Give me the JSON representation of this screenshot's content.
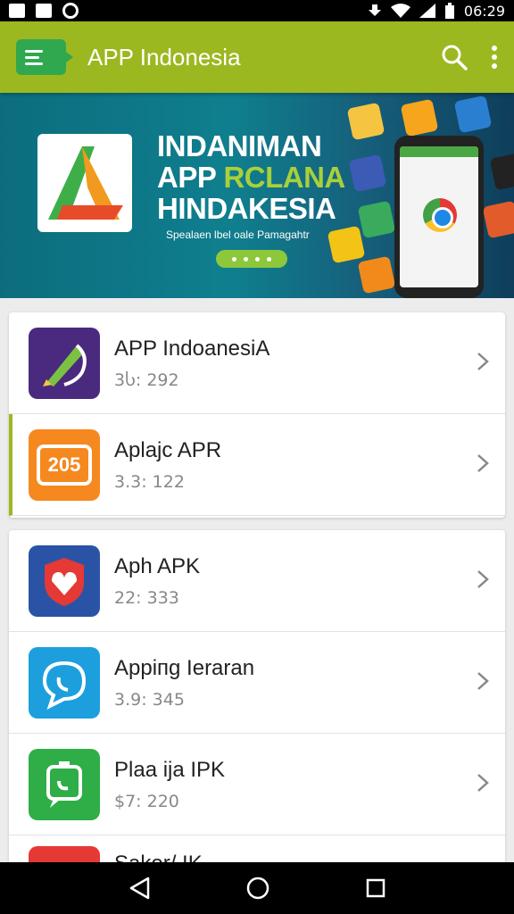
{
  "status_bar": {
    "time": "06:29"
  },
  "app_bar": {
    "title": "APP Indonesia"
  },
  "banner": {
    "line1": "INDANIMAN",
    "line2a": "APP ",
    "line2b": "RCLANA",
    "line3": "HINDAKESIA",
    "subtitle": "Spealaen lbel oale Pamagahtr"
  },
  "apps": [
    {
      "title": "APP IndoanesiA",
      "subtitle": "3Ⴑ: 292",
      "icon": "pen-icon",
      "color": "#4a2a7e"
    },
    {
      "title": "Aplajc APR",
      "subtitle": "3.3: 122",
      "icon": "badge-205-icon",
      "color": "#f5891f",
      "icon_text": "205"
    },
    {
      "title": "Aph APK",
      "subtitle": "22: 333",
      "icon": "heart-shield-icon",
      "color": "#2b53a5"
    },
    {
      "title": "Appiпg Ieraran",
      "subtitle": "3.9: 345",
      "icon": "chat-bubble-icon",
      "color": "#1d9fde"
    },
    {
      "title": "Plaa ija IPK",
      "subtitle": "$7: 220",
      "icon": "phone-bubble-icon",
      "color": "#2fae47"
    },
    {
      "title": "Sakor/ IK",
      "subtitle": "",
      "icon": "red-app-icon",
      "color": "#e53935"
    }
  ]
}
